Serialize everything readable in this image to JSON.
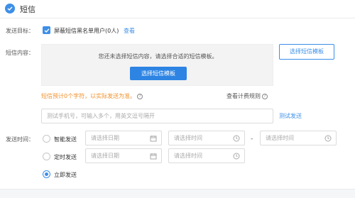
{
  "header": {
    "title": "短信"
  },
  "target": {
    "label": "发送目标：",
    "checkbox_label": "屏蔽短信黑名单用户(0人)",
    "view_link": "查看"
  },
  "content": {
    "label": "短信内容：",
    "empty_text": "您还未选择短信内容，请选择合适的短信模板。",
    "select_button": "选择短信模板",
    "select_button_side": "选择短信模板",
    "estimate_text": "短信预计0个字符，以实际发送为准。",
    "billing_rules": "查看计费规则"
  },
  "test": {
    "placeholder": "测试手机号，可输入多个，用英文逗号隔开",
    "send_link": "测试发送"
  },
  "send_time": {
    "label": "发送时间：",
    "options": [
      {
        "label": "智能发送",
        "checked": false
      },
      {
        "label": "定时发送",
        "checked": false
      },
      {
        "label": "立即发送",
        "checked": true
      }
    ],
    "date_placeholder": "请选择日期",
    "time_placeholder": "请选择时间",
    "range_separator": "-"
  },
  "colors": {
    "accent": "#3d8fe8",
    "warning": "#f0902a"
  }
}
